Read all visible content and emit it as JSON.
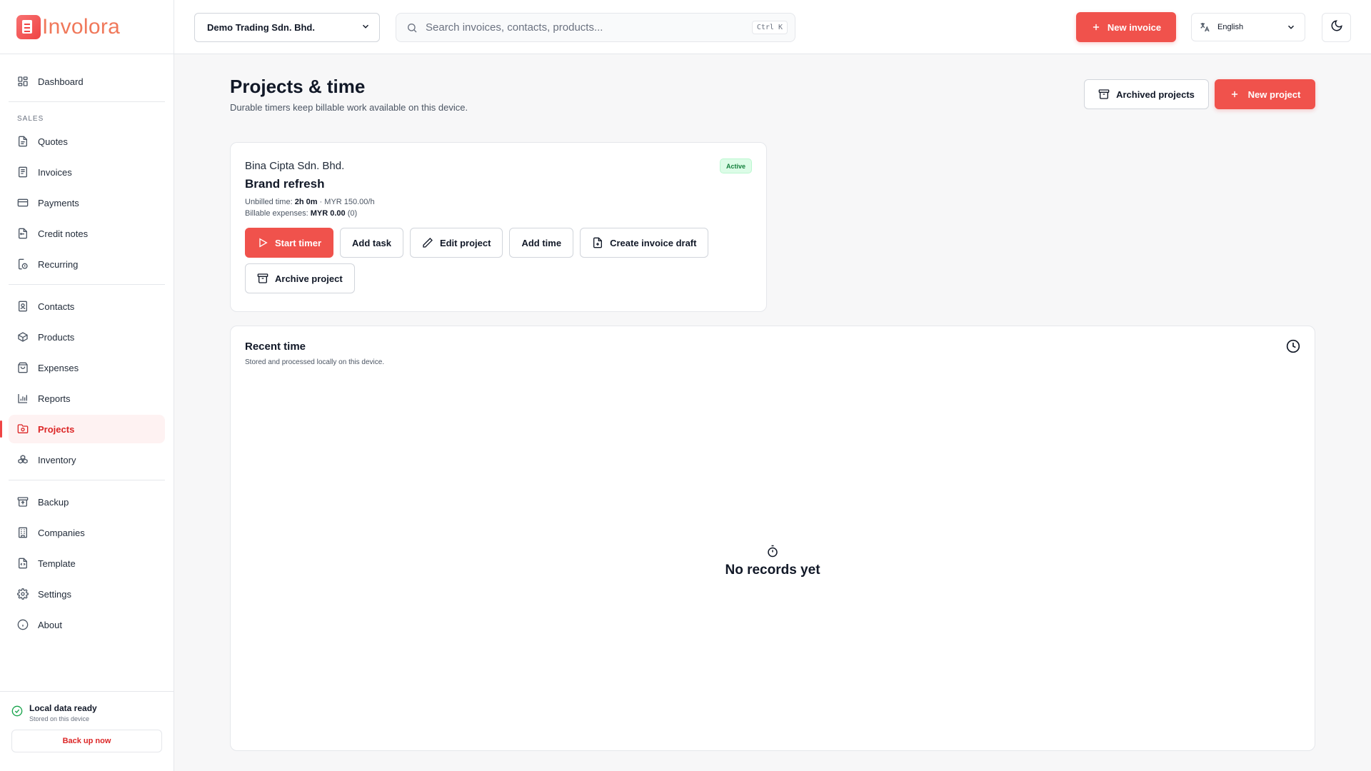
{
  "app": {
    "name": "Involora"
  },
  "topbar": {
    "company": "Demo Trading Sdn. Bhd.",
    "search_placeholder": "Search invoices, contacts, products...",
    "search_shortcut": "Ctrl K",
    "new_invoice_label": "New invoice",
    "language": "English"
  },
  "sidebar": {
    "dashboard": "Dashboard",
    "section_sales": "SALES",
    "sales_items": [
      {
        "label": "Quotes",
        "icon": "quote-icon"
      },
      {
        "label": "Invoices",
        "icon": "invoice-icon"
      },
      {
        "label": "Payments",
        "icon": "credit-card-icon"
      },
      {
        "label": "Credit notes",
        "icon": "credit-note-icon"
      },
      {
        "label": "Recurring",
        "icon": "recurring-icon"
      }
    ],
    "main_items": [
      {
        "label": "Contacts",
        "icon": "contacts-icon"
      },
      {
        "label": "Products",
        "icon": "package-icon"
      },
      {
        "label": "Expenses",
        "icon": "shopping-bag-icon"
      },
      {
        "label": "Reports",
        "icon": "bar-chart-icon"
      },
      {
        "label": "Projects",
        "icon": "folder-clock-icon",
        "active": true
      },
      {
        "label": "Inventory",
        "icon": "boxes-icon"
      }
    ],
    "system_items": [
      {
        "label": "Backup",
        "icon": "archive-upload-icon"
      },
      {
        "label": "Companies",
        "icon": "building-icon"
      },
      {
        "label": "Template",
        "icon": "file-template-icon"
      },
      {
        "label": "Settings",
        "icon": "gear-icon"
      },
      {
        "label": "About",
        "icon": "info-icon"
      }
    ],
    "footer": {
      "status_title": "Local data ready",
      "status_sub": "Stored on this device",
      "backup_label": "Back up now"
    }
  },
  "page": {
    "title": "Projects & time",
    "subtitle": "Durable timers keep billable work available on this device.",
    "archived_label": "Archived projects",
    "new_project_label": "New project"
  },
  "project": {
    "client": "Bina Cipta Sdn. Bhd.",
    "name": "Brand refresh",
    "status": "Active",
    "unbilled_label": "Unbilled time: ",
    "unbilled_value": "2h 0m",
    "rate": " · MYR 150.00/h",
    "expenses_label": "Billable expenses: ",
    "expenses_value": "MYR 0.00",
    "expenses_count": " (0)",
    "actions": {
      "start_timer": "Start timer",
      "add_task": "Add task",
      "edit_project": "Edit project",
      "add_time": "Add time",
      "create_invoice_draft": "Create invoice draft",
      "archive_project": "Archive project"
    }
  },
  "recent": {
    "title": "Recent time",
    "subtitle": "Stored and processed locally on this device.",
    "empty_text": "No records yet"
  },
  "colors": {
    "accent": "#f0524c",
    "active_bg": "#fef2f2",
    "success": "#16a34a"
  }
}
